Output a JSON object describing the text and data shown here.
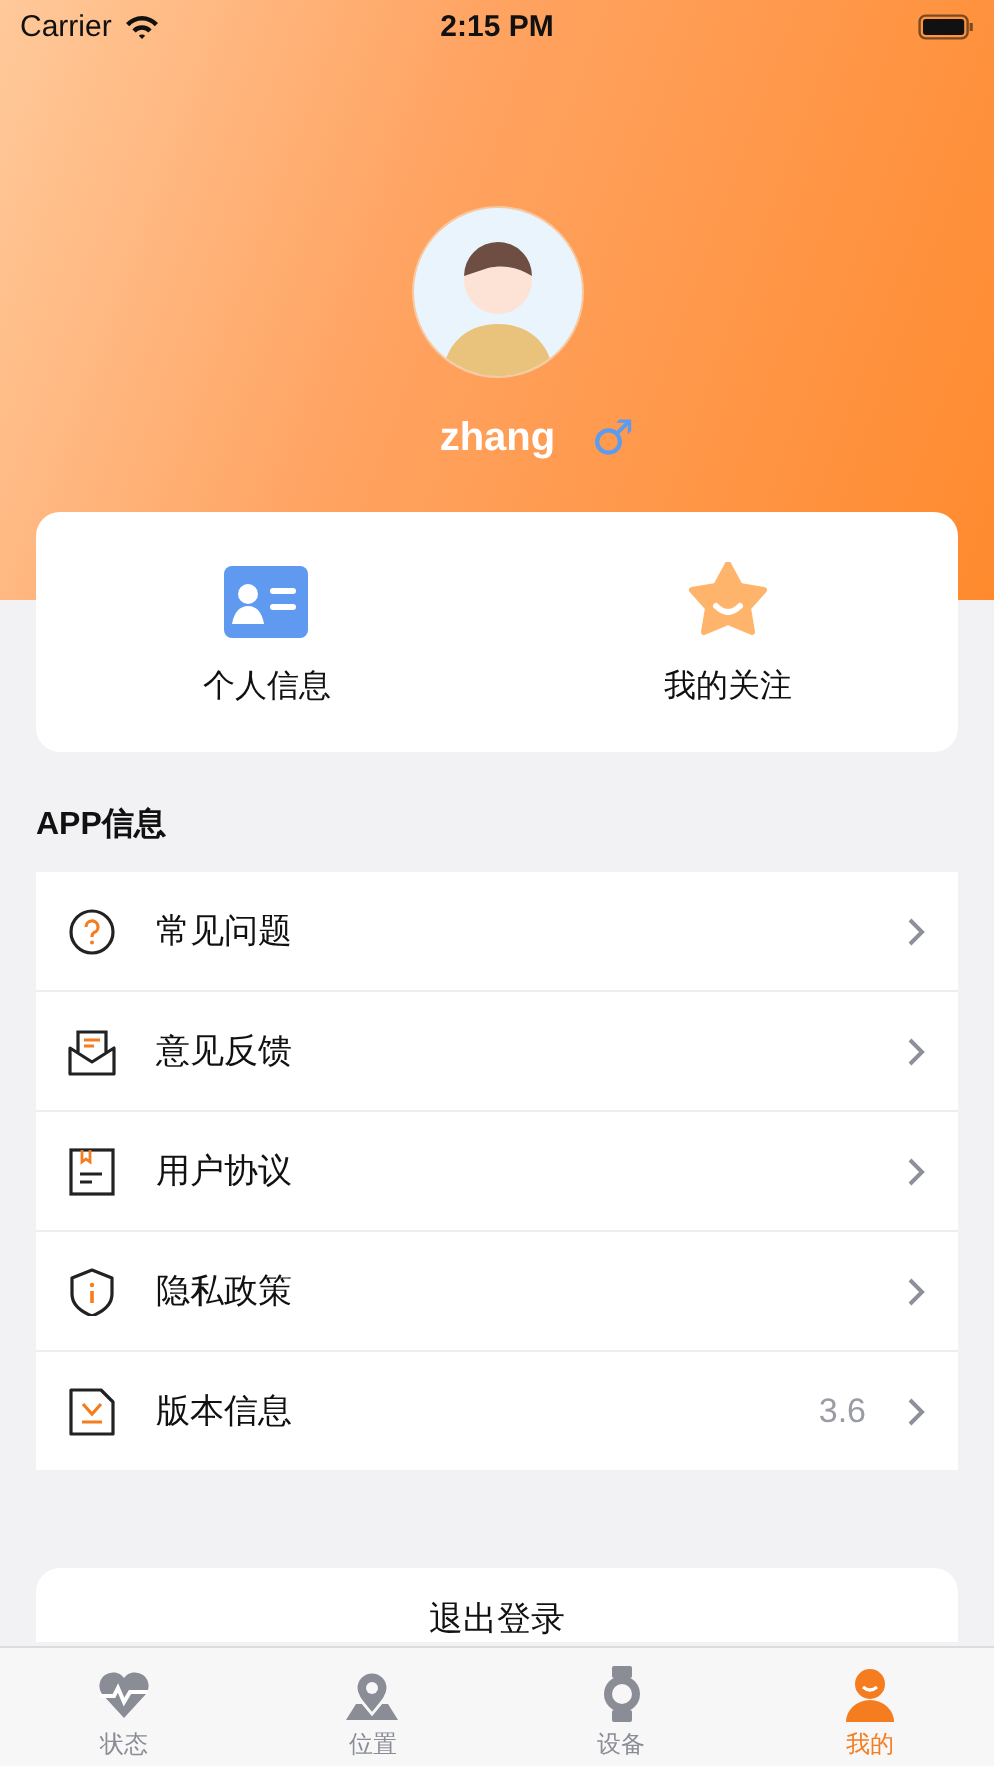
{
  "status_bar": {
    "carrier": "Carrier",
    "time": "2:15 PM"
  },
  "profile": {
    "name": "zhang",
    "gender_symbol": "♂"
  },
  "quick_actions": [
    {
      "label": "个人信息",
      "kind": "id-card"
    },
    {
      "label": "我的关注",
      "kind": "star"
    }
  ],
  "section_title": "APP信息",
  "menu": [
    {
      "label": "常见问题",
      "kind": "question"
    },
    {
      "label": "意见反馈",
      "kind": "mail"
    },
    {
      "label": "用户协议",
      "kind": "document"
    },
    {
      "label": "隐私政策",
      "kind": "shield"
    },
    {
      "label": "版本信息",
      "kind": "version",
      "value": "3.6"
    }
  ],
  "logout_button": "退出登录",
  "tabs": [
    {
      "label": "状态",
      "kind": "heart",
      "selected": false
    },
    {
      "label": "位置",
      "kind": "pin",
      "selected": false
    },
    {
      "label": "设备",
      "kind": "watch",
      "selected": false
    },
    {
      "label": "我的",
      "kind": "person",
      "selected": true
    }
  ]
}
